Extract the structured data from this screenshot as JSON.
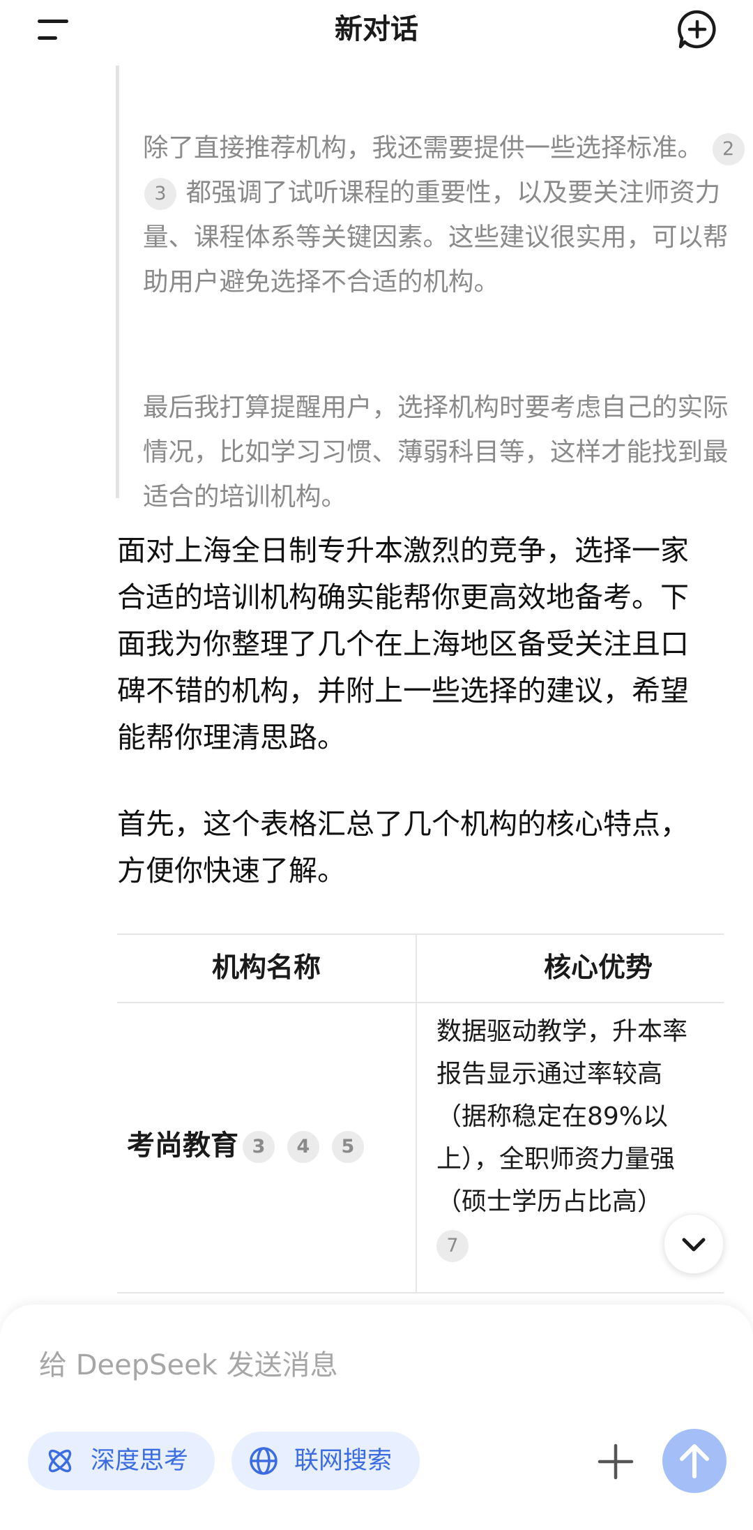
{
  "header": {
    "title": "新对话",
    "menu_icon": "menu-icon",
    "new_chat_icon": "plus-circle-icon"
  },
  "thinking": {
    "cut_line": "力。",
    "para1_a": "除了直接推荐机构，我还需要提供一些选择标准。",
    "para1_cites": [
      "2",
      "3"
    ],
    "para1_b": "都强调了试听课程的重要性，以及要关注师资力量、课程体系等关键因素。这些建议很实用，可以帮助用户避免选择不合适的机构。",
    "para2": "最后我打算提醒用户，选择机构时要考虑自己的实际情况，比如学习习惯、薄弱科目等，这样才能找到最适合的培训机构。"
  },
  "answer": {
    "intro": "面对上海全日制专升本激烈的竞争，选择一家合适的培训机构确实能帮你更高效地备考。下面我为你整理了几个在上海地区备受关注且口碑不错的机构，并附上一些选择的建议，希望能帮你理清思路。",
    "table_intro": "首先，这个表格汇总了几个机构的核心特点，方便你快速了解。"
  },
  "table": {
    "headers": [
      "机构名称",
      "核心优势"
    ],
    "rows": [
      {
        "name": "考尚教育",
        "name_cites": [
          "3",
          "4",
          "5"
        ],
        "advantage_lines": [
          "数据驱动教学，升本率",
          "报告显示通过率较高",
          "（据称稳定在89%以",
          "上），全职师资力量强",
          "（硕士学历占比高）"
        ],
        "advantage_cite": "7"
      }
    ]
  },
  "composer": {
    "placeholder": "给 DeepSeek 发送消息",
    "deep_think_label": "深度思考",
    "web_search_label": "联网搜索"
  },
  "colors": {
    "accent": "#3b6ce0",
    "chip_bg": "#e8efff",
    "send_button": "#a4bff7",
    "thinking_text": "#8a8a8a"
  }
}
